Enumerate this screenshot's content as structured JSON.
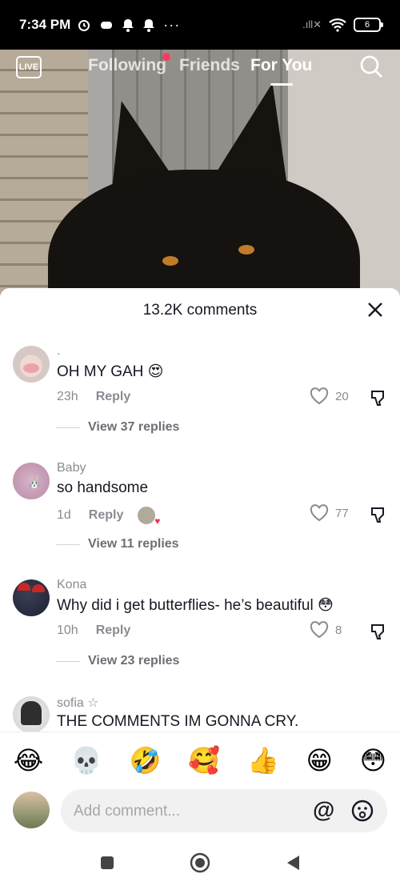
{
  "status_bar": {
    "time": "7:34 PM",
    "battery": "6",
    "signal": ".ıll✕"
  },
  "top_nav": {
    "live": "LIVE",
    "tabs": [
      {
        "label": "Following"
      },
      {
        "label": "Friends"
      },
      {
        "label": "For You"
      }
    ]
  },
  "comments": {
    "title": "13.2K comments",
    "items": [
      {
        "user": ".",
        "text": "OH MY GAH 😍",
        "time": "23h",
        "reply": "Reply",
        "likes": "20",
        "view_replies": "View 37 replies"
      },
      {
        "user": "Baby",
        "text": "so handsome",
        "time": "1d",
        "reply": "Reply",
        "likes": "77",
        "view_replies": "View 11 replies"
      },
      {
        "user": "Kona",
        "text": "Why did i get butterflies- he’s beautiful 😳",
        "time": "10h",
        "reply": "Reply",
        "likes": "8",
        "view_replies": "View 23 replies"
      },
      {
        "user": "sofia ☆",
        "text": "THE COMMENTS IM GONNA CRY."
      }
    ]
  },
  "emoji_bar": [
    "😂",
    "💀",
    "🤣",
    "🥰",
    "👍",
    "😁",
    "😳"
  ],
  "input": {
    "placeholder": "Add comment...",
    "at_symbol": "@"
  }
}
